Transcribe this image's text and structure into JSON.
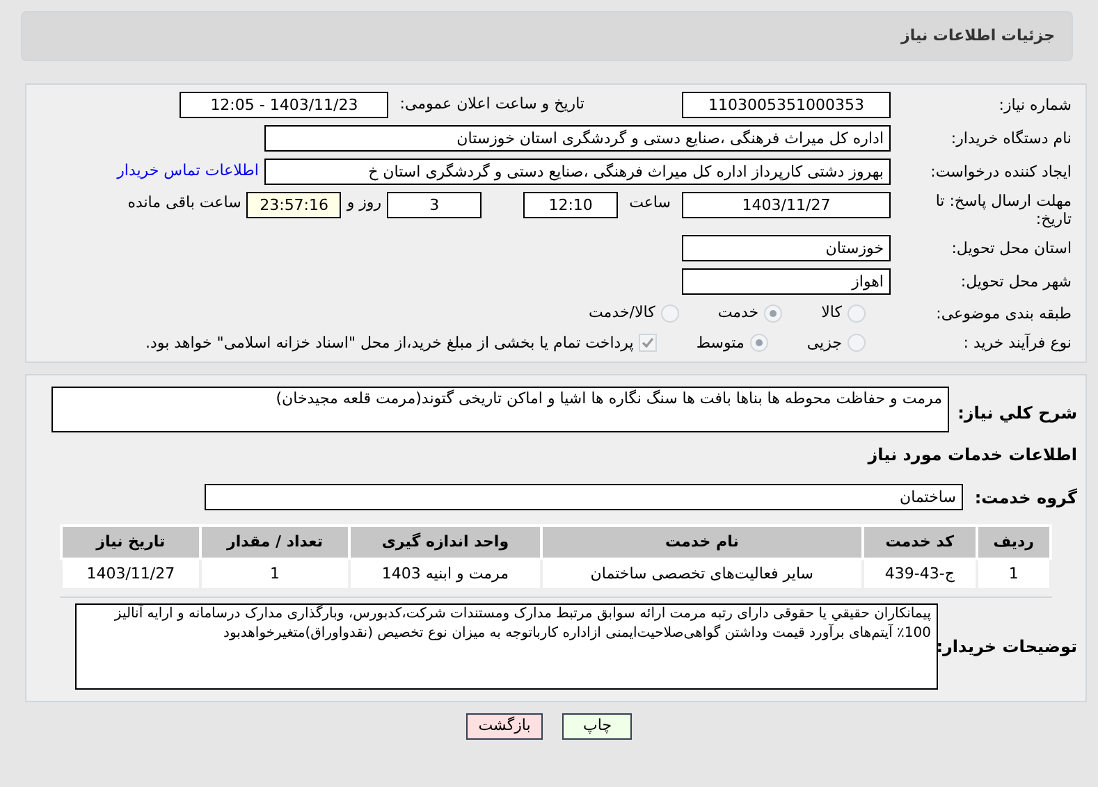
{
  "header": {
    "title": "جزئیات اطلاعات نیاز"
  },
  "need_number": {
    "label": "شماره نیاز:",
    "value": "1103005351000353"
  },
  "announce": {
    "label": "تاریخ و ساعت اعلان عمومی:",
    "value": "1403/11/23 - 12:05"
  },
  "buyer": {
    "label": "نام دستگاه خریدار:",
    "value": "اداره کل میراث فرهنگی ،صنایع دستی و گردشگری استان خوزستان"
  },
  "creator": {
    "label": "ایجاد کننده درخواست:",
    "value": "بهروز دشتی کارپرداز اداره کل میراث فرهنگی ،صنایع دستی و گردشگری استان خ",
    "link": "اطلاعات تماس خریدار"
  },
  "deadline": {
    "label": "مهلت ارسال پاسخ: تا تاریخ:",
    "date": "1403/11/27",
    "time_label": "ساعت",
    "time": "12:10",
    "days": "3",
    "days_label": "روز و",
    "remaining": "23:57:16",
    "remaining_label": "ساعت باقی مانده"
  },
  "province": {
    "label": "استان محل تحویل:",
    "value": "خوزستان"
  },
  "city": {
    "label": "شهر محل تحویل:",
    "value": "اهواز"
  },
  "category": {
    "label": "طبقه بندی موضوعی:",
    "options": [
      {
        "label": "کالا",
        "selected": false
      },
      {
        "label": "خدمت",
        "selected": true
      },
      {
        "label": "کالا/خدمت",
        "selected": false
      }
    ]
  },
  "purchase_type": {
    "label": "نوع فرآیند خرید :",
    "options": [
      {
        "label": "جزیی",
        "selected": false
      },
      {
        "label": "متوسط",
        "selected": true
      }
    ],
    "payment": {
      "checked": true,
      "label": "پرداخت تمام یا بخشی از مبلغ خرید،از محل \"اسناد خزانه اسلامی\" خواهد بود."
    }
  },
  "description": {
    "label": "شرح کلي نياز:",
    "value": "مرمت و حفاظت محوطه ها بناها بافت ها سنگ نگاره ها اشیا و اماکن تاریخی گتوند(مرمت قلعه مجیدخان)"
  },
  "services_title": "اطلاعات خدمات مورد نياز",
  "service_group": {
    "label": "گروه خدمت:",
    "value": "ساختمان"
  },
  "table": {
    "columns": [
      "ردیف",
      "کد خدمت",
      "نام خدمت",
      "واحد اندازه گیری",
      "تعداد / مقدار",
      "تاریخ نیاز"
    ],
    "rows": [
      [
        "1",
        "ج-43-439",
        "سایر فعالیت‌های تخصصی ساختمان",
        "مرمت و ابنیه 1403",
        "1",
        "1403/11/27"
      ]
    ]
  },
  "buyer_notes": {
    "label": "توضیحات خریدار:",
    "value": "پیمانکاران حقیقي یا حقوقی دارای رتبه مرمت ارائه سوابق مرتبط مدارک ومستندات شرکت،کدبورس، وبارگذاری مدارک درسامانه و ارایه آنالیز 100٪ آیتم‌های برآورد قیمت وداشتن گواهی‌صلاحیت‌ایمنی ازاداره کاربا‌توجه به میزان نوع تخصیص (نقدواوراق)متغیرخواهدبود"
  },
  "buttons": [
    {
      "kind": "print",
      "label": "چاپ"
    },
    {
      "kind": "back",
      "label": "بازگشت"
    }
  ]
}
